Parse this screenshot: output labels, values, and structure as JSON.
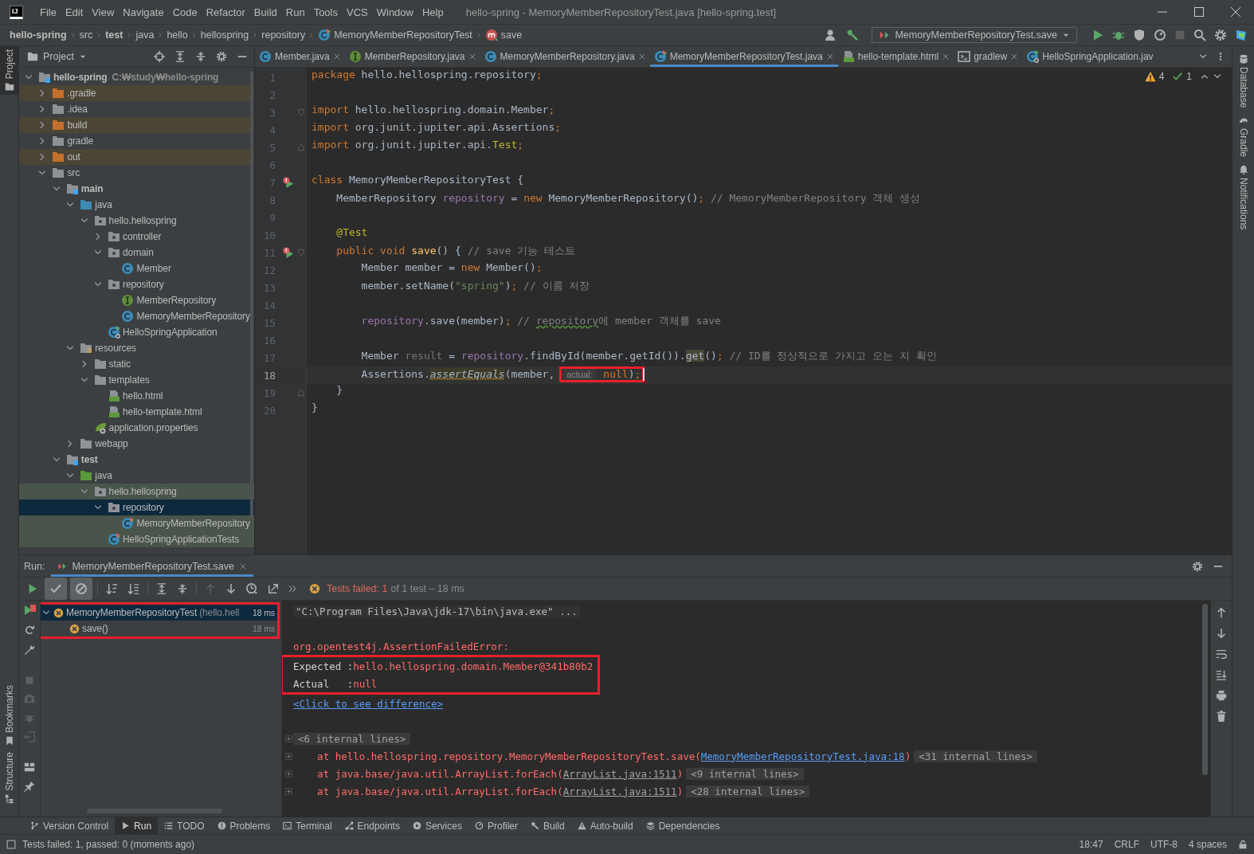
{
  "title_bar": {
    "logo": "IJ",
    "menu": [
      "File",
      "Edit",
      "View",
      "Navigate",
      "Code",
      "Refactor",
      "Build",
      "Run",
      "Tools",
      "VCS",
      "Window",
      "Help"
    ],
    "title": "hello-spring - MemoryMemberRepositoryTest.java [hello-spring.test]"
  },
  "nav_bar": {
    "breadcrumbs": [
      {
        "label": "hello-spring",
        "kind": "module"
      },
      {
        "label": "src",
        "kind": "folder"
      },
      {
        "label": "test",
        "kind": "module"
      },
      {
        "label": "java",
        "kind": "folder"
      },
      {
        "label": "hello",
        "kind": "folder"
      },
      {
        "label": "hellospring",
        "kind": "folder"
      },
      {
        "label": "repository",
        "kind": "folder"
      },
      {
        "label": "MemoryMemberRepositoryTest",
        "kind": "class"
      },
      {
        "label": "save",
        "kind": "method"
      }
    ],
    "run_config": "MemoryMemberRepositoryTest.save"
  },
  "left_strip": {
    "top": [
      {
        "label": "Project",
        "selected": true
      }
    ],
    "bottom": [
      {
        "label": "Bookmarks",
        "selected": false
      },
      {
        "label": "Structure",
        "selected": false
      }
    ]
  },
  "right_strip": [
    {
      "label": "Database",
      "kind": "database"
    },
    {
      "label": "Gradle",
      "kind": "gradle"
    },
    {
      "label": "Notifications",
      "kind": "bell"
    }
  ],
  "project": {
    "title": "Project",
    "tree": [
      {
        "name": "hello-spring",
        "kind": "module",
        "hint": "C:₩study₩hello-spring",
        "expanded": true,
        "selected": false,
        "children": [
          {
            "name": ".gradle",
            "kind": "excluded",
            "expanded": false,
            "selected": false
          },
          {
            "name": ".idea",
            "kind": "folder",
            "expanded": false,
            "selected": false
          },
          {
            "name": "build",
            "kind": "excluded",
            "expanded": false,
            "selected": false
          },
          {
            "name": "gradle",
            "kind": "folder",
            "expanded": false,
            "selected": false
          },
          {
            "name": "out",
            "kind": "excluded",
            "expanded": false,
            "selected": false
          },
          {
            "name": "src",
            "kind": "folder",
            "expanded": true,
            "selected": false,
            "children": [
              {
                "name": "main",
                "kind": "source_set",
                "expanded": true,
                "selected": false,
                "children": [
                  {
                    "name": "java",
                    "kind": "source",
                    "expanded": true,
                    "selected": false,
                    "children": [
                      {
                        "name": "hello.hellospring",
                        "kind": "package",
                        "expanded": true,
                        "selected": false,
                        "children": [
                          {
                            "name": "controller",
                            "kind": "package",
                            "expanded": false,
                            "selected": false
                          },
                          {
                            "name": "domain",
                            "kind": "package",
                            "expanded": true,
                            "selected": false,
                            "children": [
                              {
                                "name": "Member",
                                "kind": "class",
                                "selected": false
                              }
                            ]
                          },
                          {
                            "name": "repository",
                            "kind": "package",
                            "expanded": true,
                            "selected": false,
                            "children": [
                              {
                                "name": "MemberRepository",
                                "kind": "interface",
                                "selected": false
                              },
                              {
                                "name": "MemoryMemberRepository",
                                "kind": "class",
                                "selected": false
                              }
                            ]
                          },
                          {
                            "name": "HelloSpringApplication",
                            "kind": "app",
                            "selected": false
                          }
                        ]
                      }
                    ]
                  },
                  {
                    "name": "resources",
                    "kind": "resources",
                    "expanded": true,
                    "selected": false,
                    "children": [
                      {
                        "name": "static",
                        "kind": "folder",
                        "expanded": false,
                        "selected": false
                      },
                      {
                        "name": "templates",
                        "kind": "folder",
                        "expanded": true,
                        "selected": false,
                        "children": [
                          {
                            "name": "hello.html",
                            "kind": "html",
                            "selected": false
                          },
                          {
                            "name": "hello-template.html",
                            "kind": "html",
                            "selected": false
                          }
                        ]
                      },
                      {
                        "name": "application.properties",
                        "kind": "properties",
                        "selected": false
                      }
                    ]
                  },
                  {
                    "name": "webapp",
                    "kind": "folder",
                    "expanded": false,
                    "selected": false
                  }
                ]
              },
              {
                "name": "test",
                "kind": "source_set",
                "expanded": true,
                "selected": false,
                "children": [
                  {
                    "name": "java",
                    "kind": "test_source",
                    "expanded": true,
                    "selected": false,
                    "children": [
                      {
                        "name": "hello.hellospring",
                        "kind": "package",
                        "expanded": true,
                        "selected": false,
                        "children": [
                          {
                            "name": "repository",
                            "kind": "package",
                            "expanded": true,
                            "selected": true,
                            "children": [
                              {
                                "name": "MemoryMemberRepository",
                                "kind": "test_class",
                                "selected": false
                              }
                            ]
                          },
                          {
                            "name": "HelloSpringApplicationTests",
                            "kind": "test_class",
                            "selected": false
                          }
                        ]
                      }
                    ]
                  }
                ]
              }
            ]
          }
        ]
      }
    ]
  },
  "editor": {
    "tabs": [
      {
        "label": "Member.java",
        "kind": "class",
        "selected": false,
        "closable": true
      },
      {
        "label": "MemberRepository.java",
        "kind": "interface",
        "selected": false,
        "closable": true
      },
      {
        "label": "MemoryMemberRepository.java",
        "kind": "class",
        "selected": false,
        "closable": true
      },
      {
        "label": "MemoryMemberRepositoryTest.java",
        "kind": "test_class",
        "selected": true,
        "closable": true
      },
      {
        "label": "hello-template.html",
        "kind": "html",
        "selected": false,
        "closable": true
      },
      {
        "label": "gradlew",
        "kind": "terminal",
        "selected": false,
        "closable": true
      },
      {
        "label": "HelloSpringApplication.jav",
        "kind": "app",
        "selected": false,
        "closable": false
      }
    ],
    "inspections": {
      "warnings": "4",
      "passed": "1"
    },
    "lines": [
      {
        "number": "1",
        "current": false,
        "run_marker": false,
        "fold_start": false,
        "fold_end": false,
        "tokens": [
          {
            "text": "package",
            "kind": "kw"
          },
          {
            "text": " hello.hellospring.repository",
            "kind": "plain"
          },
          {
            "text": ";",
            "kind": "kw"
          }
        ]
      },
      {
        "number": "2",
        "current": false,
        "run_marker": false,
        "fold_start": false,
        "fold_end": false
      },
      {
        "number": "3",
        "current": false,
        "run_marker": false,
        "fold_start": true,
        "fold_end": false,
        "tokens": [
          {
            "text": "import",
            "kind": "kw"
          },
          {
            "text": " hello.hellospring.domain.Member",
            "kind": "plain"
          },
          {
            "text": ";",
            "kind": "kw"
          }
        ]
      },
      {
        "number": "4",
        "current": false,
        "run_marker": false,
        "fold_start": false,
        "fold_end": false,
        "tokens": [
          {
            "text": "import",
            "kind": "kw"
          },
          {
            "text": " org.junit.jupiter.api.Assertions",
            "kind": "plain"
          },
          {
            "text": ";",
            "kind": "kw"
          }
        ]
      },
      {
        "number": "5",
        "current": false,
        "run_marker": false,
        "fold_start": false,
        "fold_end": true,
        "tokens": [
          {
            "text": "import",
            "kind": "kw"
          },
          {
            "text": " org.junit.jupiter.api.",
            "kind": "plain"
          },
          {
            "text": "Test",
            "kind": "annotation"
          },
          {
            "text": ";",
            "kind": "kw"
          }
        ]
      },
      {
        "number": "6",
        "current": false,
        "run_marker": false,
        "fold_start": false,
        "fold_end": false
      },
      {
        "number": "7",
        "current": false,
        "run_marker": true,
        "fold_start": false,
        "fold_end": false,
        "tokens": [
          {
            "text": "class",
            "kind": "kw"
          },
          {
            "text": " MemoryMemberRepositoryTest {",
            "kind": "plain"
          }
        ]
      },
      {
        "number": "8",
        "current": false,
        "run_marker": false,
        "fold_start": false,
        "fold_end": false,
        "tokens": [
          {
            "text": "    MemberRepository ",
            "kind": "plain"
          },
          {
            "text": "repository",
            "kind": "field"
          },
          {
            "text": " = ",
            "kind": "plain"
          },
          {
            "text": "new",
            "kind": "kw"
          },
          {
            "text": " MemoryMemberRepository()",
            "kind": "plain"
          },
          {
            "text": ";",
            "kind": "kw"
          },
          {
            "text": " // MemoryMemberRepository 객체 생성",
            "kind": "comment"
          }
        ]
      },
      {
        "number": "9",
        "current": false,
        "run_marker": false,
        "fold_start": false,
        "fold_end": false
      },
      {
        "number": "10",
        "current": false,
        "run_marker": false,
        "fold_start": false,
        "fold_end": false,
        "tokens": [
          {
            "text": "    @Test",
            "kind": "annotation"
          }
        ]
      },
      {
        "number": "11",
        "current": false,
        "run_marker": true,
        "fold_start": true,
        "fold_end": false,
        "tokens": [
          {
            "text": "    public void ",
            "kind": "kw"
          },
          {
            "text": "save",
            "kind": "method"
          },
          {
            "text": "() { ",
            "kind": "plain"
          },
          {
            "text": "// save 기능 테스트",
            "kind": "comment"
          }
        ]
      },
      {
        "number": "12",
        "current": false,
        "run_marker": false,
        "fold_start": false,
        "fold_end": false,
        "tokens": [
          {
            "text": "        Member member = ",
            "kind": "plain"
          },
          {
            "text": "new",
            "kind": "kw"
          },
          {
            "text": " Member()",
            "kind": "plain"
          },
          {
            "text": ";",
            "kind": "kw"
          }
        ]
      },
      {
        "number": "13",
        "current": false,
        "run_marker": false,
        "fold_start": false,
        "fold_end": false,
        "tokens": [
          {
            "text": "        member.setName(",
            "kind": "plain"
          },
          {
            "text": "\"spring\"",
            "kind": "string"
          },
          {
            "text": ")",
            "kind": "plain"
          },
          {
            "text": ";",
            "kind": "kw"
          },
          {
            "text": " // 이름 저장",
            "kind": "comment"
          }
        ]
      },
      {
        "number": "14",
        "current": false,
        "run_marker": false,
        "fold_start": false,
        "fold_end": false
      },
      {
        "number": "15",
        "current": false,
        "run_marker": false,
        "fold_start": false,
        "fold_end": false,
        "tokens": [
          {
            "text": "        repository",
            "kind": "field"
          },
          {
            "text": ".save(member)",
            "kind": "plain"
          },
          {
            "text": ";",
            "kind": "kw"
          },
          {
            "text": " // ",
            "kind": "comment"
          },
          {
            "text": "repository",
            "kind": "typo"
          },
          {
            "text": "에 member 객체를 save",
            "kind": "comment"
          }
        ]
      },
      {
        "number": "16",
        "current": false,
        "run_marker": false,
        "fold_start": false,
        "fold_end": false
      },
      {
        "number": "17",
        "current": false,
        "run_marker": false,
        "fold_start": false,
        "fold_end": false,
        "tokens": [
          {
            "text": "        Member ",
            "kind": "plain"
          },
          {
            "text": "result",
            "kind": "unused"
          },
          {
            "text": " = ",
            "kind": "plain"
          },
          {
            "text": "repository",
            "kind": "field"
          },
          {
            "text": ".findById(member.getId()).",
            "kind": "plain"
          },
          {
            "text": "get",
            "kind": "highlight"
          },
          {
            "text": "()",
            "kind": "plain"
          },
          {
            "text": ";",
            "kind": "kw"
          },
          {
            "text": " // ID를 정상적으로 가지고 오는 지 확인",
            "kind": "comment"
          }
        ]
      },
      {
        "number": "18",
        "current": true,
        "run_marker": false,
        "fold_start": false,
        "fold_end": false,
        "tokens": [
          {
            "text": "        Assertions.",
            "kind": "plain",
            "boxed": false
          },
          {
            "text": "assertEquals",
            "kind": "static_warn",
            "boxed": false
          },
          {
            "text": "(member, ",
            "kind": "plain",
            "boxed": false
          },
          {
            "text": "actual:",
            "kind": "hint",
            "boxed": true
          },
          {
            "text": " null",
            "kind": "kw",
            "boxed": true
          },
          {
            "text": ")",
            "kind": "plain",
            "boxed": true
          },
          {
            "text": ";",
            "kind": "kw",
            "boxed": true
          }
        ]
      },
      {
        "number": "19",
        "current": false,
        "run_marker": false,
        "fold_start": false,
        "fold_end": true,
        "tokens": [
          {
            "text": "    }",
            "kind": "plain"
          }
        ]
      },
      {
        "number": "20",
        "current": false,
        "run_marker": false,
        "fold_start": false,
        "fold_end": false,
        "tokens": [
          {
            "text": "}",
            "kind": "plain"
          }
        ]
      }
    ]
  },
  "run": {
    "label": "Run:",
    "tab": "MemoryMemberRepositoryTest.save",
    "toggles": [
      {
        "kind": "passed",
        "on": true
      },
      {
        "kind": "ignored",
        "on": true
      }
    ],
    "status": {
      "failed": "Tests failed: 1",
      "rest": "of 1 test – 18 ms"
    },
    "tree": {
      "boxed": true,
      "items": [
        {
          "name": "MemoryMemberRepositoryTest",
          "detail": "(hello.hell",
          "time": "18 ms",
          "kind": "failed",
          "selected": true,
          "expanded": true,
          "children": [
            {
              "name": "save()",
              "time": "18 ms",
              "kind": "failed",
              "selected": false
            }
          ]
        }
      ]
    },
    "console": [
      {
        "lines": [
          {
            "kind": "command",
            "text": "\"C:\\Program Files\\Java\\jdk-17\\bin\\java.exe\" ...",
            "boxed": false
          }
        ]
      },
      {
        "lines": [
          {
            "kind": "error",
            "text": "org.opentest4j.AssertionFailedError:",
            "boxed": false
          },
          {
            "kind": "compare",
            "label": "Expected :",
            "text": "hello.hellospring.domain.Member@341b80b2",
            "boxed": true
          },
          {
            "kind": "compare",
            "label": "Actual   :",
            "text": "null",
            "boxed": true
          },
          {
            "kind": "link",
            "text": "<Click to see difference>",
            "boxed": false
          }
        ]
      },
      {
        "lines": [
          {
            "kind": "folded",
            "text": "<6 internal lines>",
            "boxed": false
          },
          {
            "kind": "trace_source",
            "text": "    at hello.hellospring.repository.MemoryMemberRepositoryTest.save(",
            "link": "MemoryMemberRepositoryTest.java:18",
            "close": ")",
            "folded": "<31 internal lines>",
            "boxed": false
          },
          {
            "kind": "trace_library",
            "text": "    at java.base/java.util.ArrayList.forEach(",
            "link": "ArrayList.java:1511",
            "close": ")",
            "folded": "<9 internal lines>",
            "boxed": false
          },
          {
            "kind": "trace_library",
            "text": "    at java.base/java.util.ArrayList.forEach(",
            "link": "ArrayList.java:1511",
            "close": ")",
            "folded": "<28 internal lines>",
            "boxed": false
          }
        ]
      }
    ]
  },
  "tool_tabs": [
    {
      "label": "Version Control",
      "kind": "vcs",
      "selected": false
    },
    {
      "label": "Run",
      "kind": "run",
      "selected": true
    },
    {
      "label": "TODO",
      "kind": "todo",
      "selected": false
    },
    {
      "label": "Problems",
      "kind": "problems",
      "selected": false
    },
    {
      "label": "Terminal",
      "kind": "terminal",
      "selected": false
    },
    {
      "label": "Endpoints",
      "kind": "endpoints",
      "selected": false
    },
    {
      "label": "Services",
      "kind": "services",
      "selected": false
    },
    {
      "label": "Profiler",
      "kind": "profiler",
      "selected": false
    },
    {
      "label": "Build",
      "kind": "build",
      "selected": false
    },
    {
      "label": "Auto-build",
      "kind": "autobuild",
      "selected": false
    },
    {
      "label": "Dependencies",
      "kind": "deps",
      "selected": false
    }
  ],
  "status_bar": {
    "message": "Tests failed: 1, passed: 0 (moments ago)",
    "items": [
      "18:47",
      "CRLF",
      "UTF-8",
      "4 spaces"
    ]
  }
}
